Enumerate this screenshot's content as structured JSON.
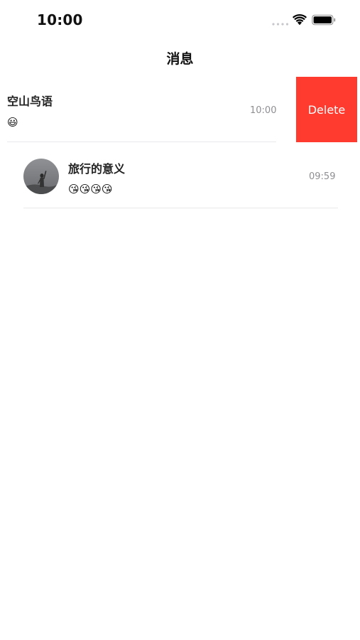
{
  "status_bar": {
    "time": "10:00"
  },
  "nav": {
    "title": "消息"
  },
  "conversations": [
    {
      "name": "空山鸟语",
      "last_message": "😃",
      "time": "10:00",
      "swipe_action": "Delete"
    },
    {
      "name": "旅行的意义",
      "last_message": "😘😘😘😘",
      "time": "09:59"
    }
  ],
  "colors": {
    "delete": "#ff3b30",
    "time_text": "#8e8e93",
    "divider": "#e9e9ec"
  },
  "icons": [
    "cellular-signal-icon",
    "wifi-icon",
    "battery-icon"
  ]
}
